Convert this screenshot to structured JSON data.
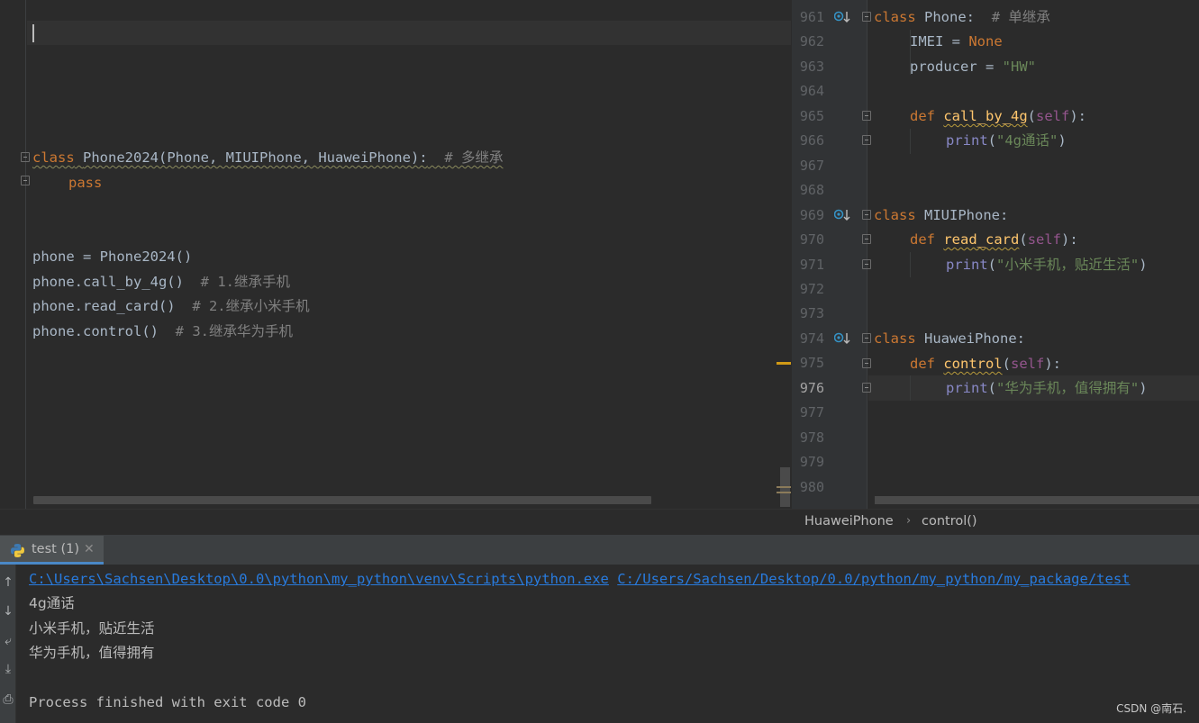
{
  "left_editor": {
    "lines": {
      "class_line": {
        "kw": "class",
        "name": "Phone2024",
        "bases": "(Phone, MIUIPhone, HuaweiPhone):",
        "comment": "# 多继承"
      },
      "pass_kw": "pass",
      "assign": "phone = Phone2024()",
      "call1": "phone.call_by_4g()",
      "call1_comment": "# 1.继承手机",
      "call2": "phone.read_card()",
      "call2_comment": "# 2.继承小米手机",
      "call3": "phone.control()",
      "call3_comment": "# 3.继承华为手机"
    }
  },
  "right_editor": {
    "line_numbers": [
      "961",
      "962",
      "963",
      "964",
      "965",
      "966",
      "967",
      "968",
      "969",
      "970",
      "971",
      "972",
      "973",
      "974",
      "975",
      "976",
      "977",
      "978",
      "979",
      "980"
    ],
    "current_line": "976",
    "code": {
      "l961_kw": "class",
      "l961_name": "Phone:",
      "l961_comment": "# 单继承",
      "l962_name": "IMEI",
      "l962_eq": " = ",
      "l962_val": "None",
      "l963_name": "producer",
      "l963_eq": " = ",
      "l963_val": "\"HW\"",
      "l965_kw": "def",
      "l965_fn": "call_by_4g",
      "l965_self": "self",
      "l966_print": "print",
      "l966_str": "\"4g通话\"",
      "l969_kw": "class",
      "l969_name": "MIUIPhone:",
      "l970_kw": "def",
      "l970_fn": "read_card",
      "l970_self": "self",
      "l971_print": "print",
      "l971_str": "\"小米手机，贴近生活\"",
      "l974_kw": "class",
      "l974_name": "HuaweiPhone:",
      "l975_kw": "def",
      "l975_fn": "control",
      "l975_self": "self",
      "l976_print": "print",
      "l976_str": "\"华为手机，值得拥有\""
    }
  },
  "breadcrumb": {
    "class_name": "HuaweiPhone",
    "separator": "›",
    "method_name": "control()"
  },
  "run_panel": {
    "tab_label": "test (1)",
    "tab_close": "✕",
    "toolbar_icons": [
      "arrow-up-icon",
      "arrow-down-icon",
      "soft-wrap-icon",
      "scroll-to-end-icon",
      "print-icon"
    ],
    "toolbar_glyphs": [
      "↑",
      "↓",
      "⤶",
      "⤓",
      "⎙"
    ],
    "console": {
      "interpreter_path": "C:\\Users\\Sachsen\\Desktop\\0.0\\python\\my_python\\venv\\Scripts\\python.exe",
      "script_path": "C:/Users/Sachsen/Desktop/0.0/python/my_python/my_package/test",
      "out1": "4g通话",
      "out2": "小米手机，贴近生活",
      "out3": "华为手机，值得拥有",
      "finish": "Process finished with exit code 0"
    }
  },
  "watermark": "CSDN @南石."
}
